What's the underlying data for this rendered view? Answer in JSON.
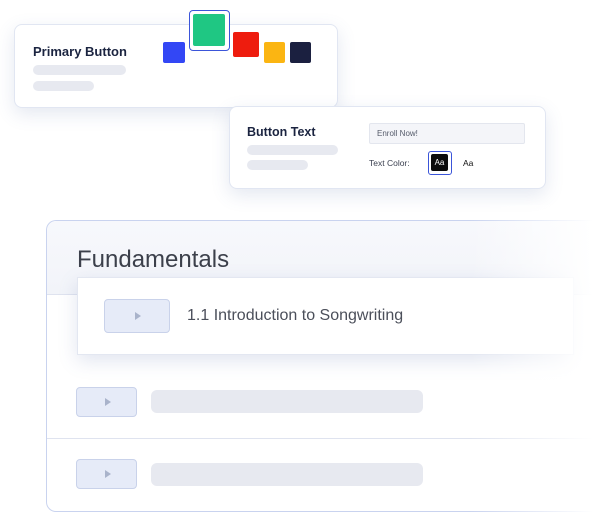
{
  "primary_button_card": {
    "title": "Primary Button",
    "swatches": [
      {
        "name": "blue",
        "color": "#3347f5"
      },
      {
        "name": "green",
        "color": "#1fc783",
        "selected": true
      },
      {
        "name": "red",
        "color": "#ee1c0e"
      },
      {
        "name": "amber",
        "color": "#fbb512"
      },
      {
        "name": "navy",
        "color": "#1b2040"
      }
    ]
  },
  "button_text_card": {
    "title": "Button Text",
    "input_value": "Enroll Now!",
    "text_color_label": "Text Color:",
    "dark_option_label": "Aa",
    "light_option_label": "Aa"
  },
  "course": {
    "section_title": "Fundamentals",
    "lessons": [
      {
        "title": "1.1 Introduction to Songwriting"
      }
    ]
  },
  "icons": {
    "lesson_thumbnail": "play-icon"
  },
  "colors": {
    "accent": "#3b55d9",
    "skeleton": "#e7e9f0",
    "card_border": "#c9d3ef"
  }
}
